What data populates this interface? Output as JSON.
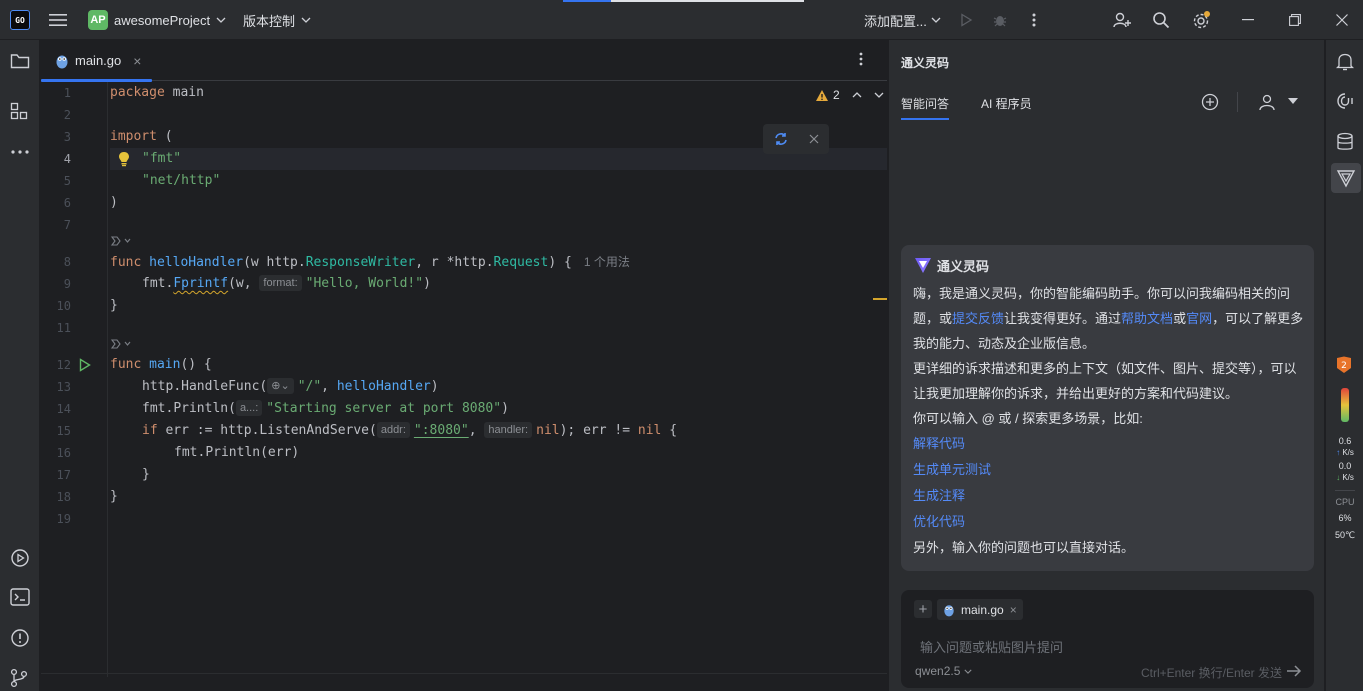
{
  "colors": {
    "accent": "#3574f0",
    "link": "#548af7",
    "string": "#6aab73",
    "keyword": "#cf8e6d",
    "function": "#56a8f5"
  },
  "titlebar": {
    "logo_top": "GO",
    "logo_bottom": "",
    "project_badge": "AP",
    "project_name": "awesomeProject",
    "vcs_label": "版本控制",
    "run_config_label": "添加配置...",
    "icons": [
      "hamburger-menu-icon",
      "run-icon",
      "debug-icon",
      "more-icon",
      "add-user-icon",
      "search-icon",
      "settings-icon",
      "minimize-icon",
      "restore-icon",
      "close-icon"
    ]
  },
  "left_strip": {
    "icons": [
      "project-folder-icon",
      "structure-icon",
      "more-tools-icon",
      "run-services-icon",
      "terminal-icon",
      "problems-icon",
      "git-icon"
    ]
  },
  "editor": {
    "tab": {
      "label": "main.go",
      "close": "×",
      "icon": "go-gopher-icon"
    },
    "warnings": {
      "count": "2"
    },
    "line_numbers": [
      "1",
      "2",
      "3",
      "4",
      "5",
      "6",
      "7",
      "8",
      "9",
      "10",
      "11",
      "12",
      "13",
      "14",
      "15",
      "16",
      "17",
      "18",
      "19"
    ],
    "usage_hint": "1 个用法",
    "hints": {
      "format": "format:",
      "a": "a...:",
      "addr": "addr:",
      "handler": "handler:"
    },
    "code": {
      "l1_kw": "package",
      "l1_id": " main",
      "l3_kw": "import",
      "l3_rest": " (",
      "l4_str": "\"fmt\"",
      "l5_str": "\"net/http\"",
      "l6": ")",
      "l8_kw": "func",
      "l8_fn": "helloHandler",
      "l8_a": "(w ",
      "l8_pkg1": "http",
      "l8_dot1": ".",
      "l8_t1": "ResponseWriter",
      "l8_b": ", r *",
      "l8_pkg2": "http",
      "l8_dot2": ".",
      "l8_t2": "Request",
      "l8_c": ") {",
      "l9_pkg": "fmt",
      "l9_dot": ".",
      "l9_fn": "Fprintf",
      "l9_a": "(w, ",
      "l9_str": "\"Hello, World!\"",
      "l9_b": ")",
      "l10": "}",
      "l12_kw": "func",
      "l12_fn": "main",
      "l12_rest": "() {",
      "l13_pkg": "http",
      "l13_dot": ".",
      "l13_fn": "HandleFunc",
      "l13_a": "(",
      "l13_str": "\"/\"",
      "l13_b": ", ",
      "l13_id": "helloHandler",
      "l13_c": ")",
      "l14_pkg": "fmt",
      "l14_dot": ".",
      "l14_fn": "Println",
      "l14_a": "(",
      "l14_str": "\"Starting server at port 8080\"",
      "l14_b": ")",
      "l15_kw": "if",
      "l15_a": " err := ",
      "l15_pkg": "http",
      "l15_dot": ".",
      "l15_fn": "ListenAndServe",
      "l15_b": "(",
      "l15_str": "\":8080\"",
      "l15_c": ", ",
      "l15_nil": "nil",
      "l15_d": "); err != ",
      "l15_nil2": "nil",
      "l15_e": " {",
      "l16_pkg": "fmt",
      "l16_dot": ".",
      "l16_fn": "Println",
      "l16_a": "(err)",
      "l17": "}",
      "l18": "}"
    }
  },
  "ai_panel": {
    "title": "通义灵码",
    "tabs": [
      "智能问答",
      "AI 程序员"
    ],
    "welcome": {
      "head": "通义灵码",
      "p1_a": "嗨，我是通义灵码，你的智能编码助手。你可以问我编码相关的问题，或",
      "p1_link1": "提交反馈",
      "p1_b": "让我变得更好。通过",
      "p1_link2": "帮助文档",
      "p1_c": "或",
      "p1_link3": "官网",
      "p1_d": "，可以了解更多我的能力、动态及企业版信息。",
      "p2": "更详细的诉求描述和更多的上下文（如文件、图片、提交等），可以让我更加理解你的诉求，并给出更好的方案和代码建议。",
      "p3": "你可以输入 @ 或 / 探索更多场景，比如:",
      "links": [
        "解释代码",
        "生成单元测试",
        "生成注释",
        "优化代码"
      ],
      "p4": "另外，输入你的问题也可以直接对话。"
    },
    "input": {
      "add": "+",
      "context_chip": "main.go",
      "chip_close": "×",
      "placeholder": "输入问题或粘贴图片提问",
      "model": "qwen2.5",
      "send_hint": "Ctrl+Enter 换行/Enter 发送"
    }
  },
  "right_strip": {
    "icons": [
      "notifications-icon",
      "ai-assistant-icon",
      "database-icon",
      "tongyi-lingma-icon",
      "plugin-badge-icon",
      "memory-gauge-icon"
    ],
    "net_up": "0.6",
    "net_up_unit": "K/s",
    "net_down": "0.0",
    "net_down_unit": "K/s",
    "cpu_label": "CPU",
    "cpu_value": "6%",
    "temp": "50℃",
    "badge": "2"
  }
}
